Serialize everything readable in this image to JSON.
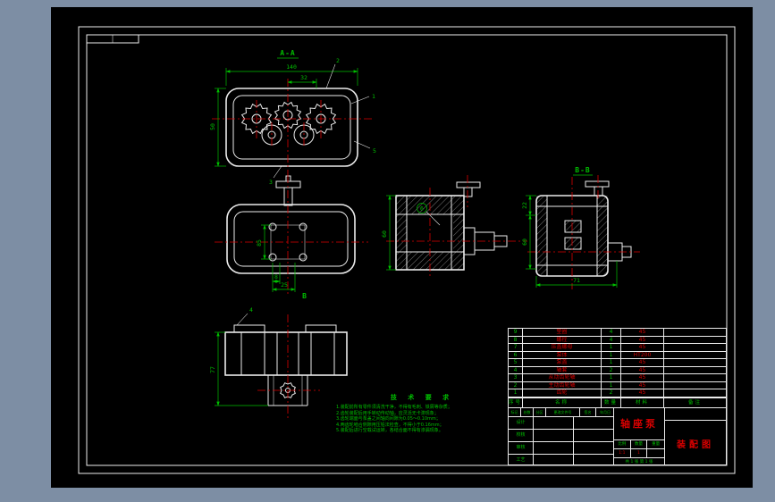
{
  "colors": {
    "winbg": "#7d8ea4",
    "canvas": "#000000",
    "line": "#ececec",
    "dim": "#00bf00",
    "red": "#d90000"
  },
  "views": {
    "sectionA": {
      "label": "A-A",
      "dim_width": "140",
      "dim_pitch": "32",
      "dim_height": "50",
      "callout1": "1",
      "callout2": "2",
      "callout3": "3",
      "callout5": "5"
    },
    "cover": {
      "dim_square": "85",
      "dim_small": "8",
      "dim_pitch": "25",
      "label": "B"
    },
    "side": {
      "dim_height": "60",
      "callout6": "6"
    },
    "sectionB": {
      "label": "B-B",
      "dim_top": "22",
      "dim_bottom": "60",
      "dim_width": "71"
    },
    "front": {
      "dim_height": "77",
      "callout4": "4"
    }
  },
  "notes": {
    "title": "技 术 要 求",
    "lines": [
      "1.装配前所有零件须清洗干净，不得有毛刺、铁屑等杂质；",
      "2.齿轮装配后用手转动传动轴，应灵活无卡滞现象；",
      "3.齿轮端面与泵盖之间轴向间隙为0.05～0.10mm；",
      "4.两齿轮啮合侧隙用压铅法检查，不得小于0.16mm；",
      "5.装配后进行空载试运转，各结合面不得有渗漏现象。"
    ]
  },
  "bom": {
    "headers": [
      "序号",
      "名称",
      "数量",
      "材料",
      "备注"
    ],
    "rows": [
      {
        "no": "9",
        "name": "垫圈",
        "qty": "4",
        "mat": "45"
      },
      {
        "no": "8",
        "name": "螺栓",
        "qty": "4",
        "mat": "45"
      },
      {
        "no": "7",
        "name": "压盖螺母",
        "qty": "1",
        "mat": "45"
      },
      {
        "no": "6",
        "name": "泵体",
        "qty": "1",
        "mat": "HT200"
      },
      {
        "no": "5",
        "name": "泵盖",
        "qty": "1",
        "mat": "45"
      },
      {
        "no": "4",
        "name": "轴套",
        "qty": "2",
        "mat": "45"
      },
      {
        "no": "3",
        "name": "从动齿轮轴",
        "qty": "1",
        "mat": "45"
      },
      {
        "no": "2",
        "name": "主动齿轮轴",
        "qty": "1",
        "mat": "45"
      },
      {
        "no": "1",
        "name": "齿轮",
        "qty": "2",
        "mat": "45"
      }
    ]
  },
  "title_block": {
    "part_name": "轴座泵",
    "sheet_label": "装配图",
    "rev_headers": [
      "标记",
      "处数",
      "分区",
      "更改文件号",
      "签名",
      "年月日"
    ],
    "staff": [
      "设计",
      "校核",
      "审核",
      "工艺"
    ],
    "scale_headers": [
      "比例",
      "数量",
      "重量"
    ],
    "scale_values": [
      "1:1",
      "1",
      ""
    ],
    "sheet_info": "共 1 张  第 1 张"
  }
}
